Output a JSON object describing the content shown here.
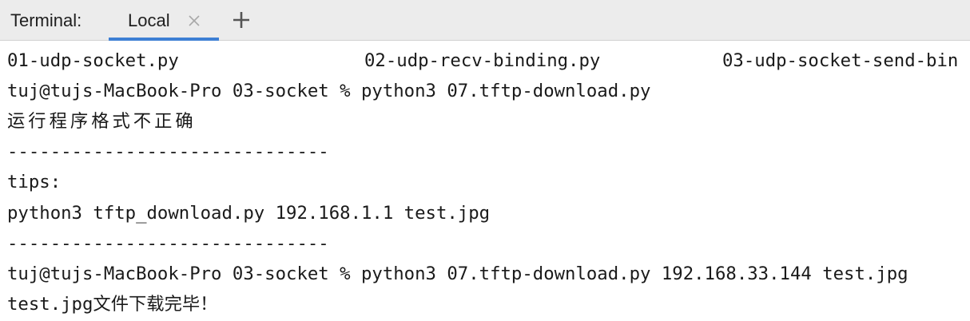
{
  "tabbar": {
    "title": "Terminal:",
    "active_tab": "Local"
  },
  "terminal": {
    "ls_files": [
      "01-udp-socket.py",
      "02-udp-recv-binding.py",
      "03-udp-socket-send-bin"
    ],
    "lines": [
      "tuj@tujs-MacBook-Pro 03-socket % python3 07.tftp-download.py",
      "运行程序格式不正确",
      "------------------------------",
      "tips:",
      "python3 tftp_download.py 192.168.1.1 test.jpg",
      "------------------------------",
      "tuj@tujs-MacBook-Pro 03-socket % python3 07.tftp-download.py 192.168.33.144 test.jpg",
      "test.jpg文件下载完毕！"
    ]
  },
  "colors": {
    "tab_underline": "#3d7fd4",
    "header_bg": "#ececec"
  },
  "icons": {
    "close": "close-icon",
    "add": "plus-icon"
  }
}
